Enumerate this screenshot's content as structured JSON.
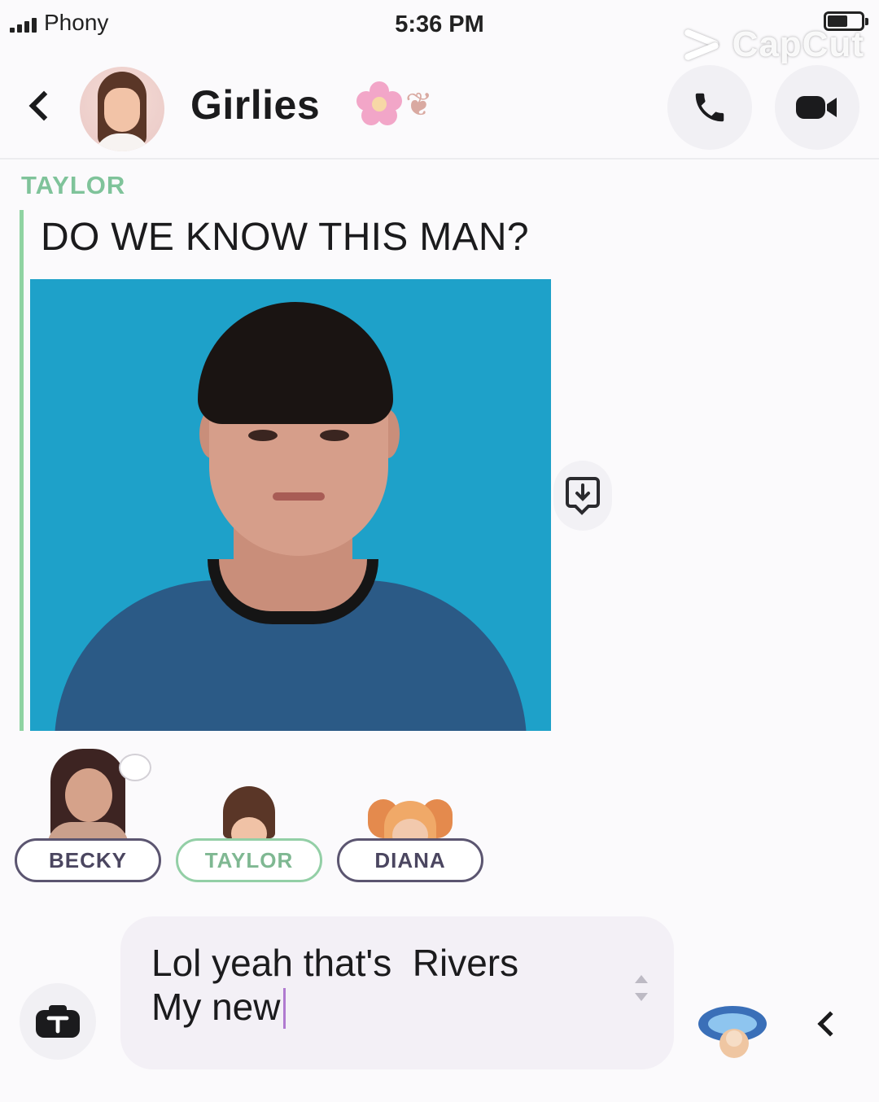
{
  "status_bar": {
    "carrier": "Phony",
    "time": "5:36 PM",
    "battery_level": 0.5
  },
  "watermark": {
    "text": "CapCut"
  },
  "header": {
    "title": "Girlies",
    "title_emoji": [
      "flower-icon",
      "ribbon-icon"
    ],
    "back_icon": "chevron-left-icon",
    "call_icon": "phone-icon",
    "video_icon": "video-camera-icon"
  },
  "messages": [
    {
      "sender": "TAYLOR",
      "sender_color": "#7fc39a",
      "text": "DO WE KNOW THIS MAN?",
      "attachment": {
        "type": "photo",
        "background_color": "#1ea1c9",
        "save_icon": "save-download-icon"
      }
    }
  ],
  "read_receipts": [
    {
      "name": "BECKY"
    },
    {
      "name": "TAYLOR"
    },
    {
      "name": "DIANA"
    }
  ],
  "composer": {
    "text": "Lol yeah that's  Rivers\nMy new",
    "camera_icon": "camera-icon",
    "sticker_icon": "sticker-icon",
    "collapse_icon": "chevron-left-icon"
  },
  "colors": {
    "accent_green": "#8fd3a2",
    "pill_border": "#5b5570",
    "caret": "#b07ad0"
  }
}
